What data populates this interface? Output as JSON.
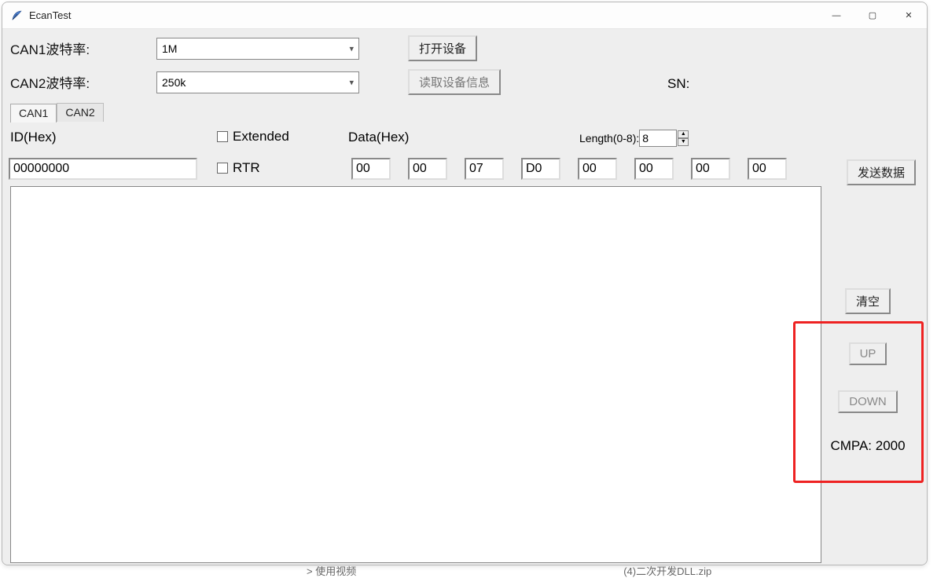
{
  "window": {
    "title": "EcanTest"
  },
  "baud": {
    "can1_label": "CAN1波特率:",
    "can1_value": "1M",
    "can2_label": "CAN2波特率:",
    "can2_value": "250k"
  },
  "buttons": {
    "open": "打开设备",
    "read_info": "读取设备信息",
    "send": "发送数据",
    "clear": "清空",
    "up": "UP",
    "down": "DOWN"
  },
  "sn_label": "SN:",
  "tabs": {
    "can1": "CAN1",
    "can2": "CAN2"
  },
  "id": {
    "label": "ID(Hex)",
    "value": "00000000"
  },
  "flags": {
    "extended": "Extended",
    "rtr": "RTR"
  },
  "data": {
    "label": "Data(Hex)",
    "bytes": [
      "00",
      "00",
      "07",
      "D0",
      "00",
      "00",
      "00",
      "00"
    ]
  },
  "length": {
    "label": "Length(0-8):",
    "value": "8"
  },
  "cmpa": "CMPA: 2000",
  "peek": {
    "a": "> 使用视频",
    "b": "(4)二次开发DLL.zip"
  }
}
